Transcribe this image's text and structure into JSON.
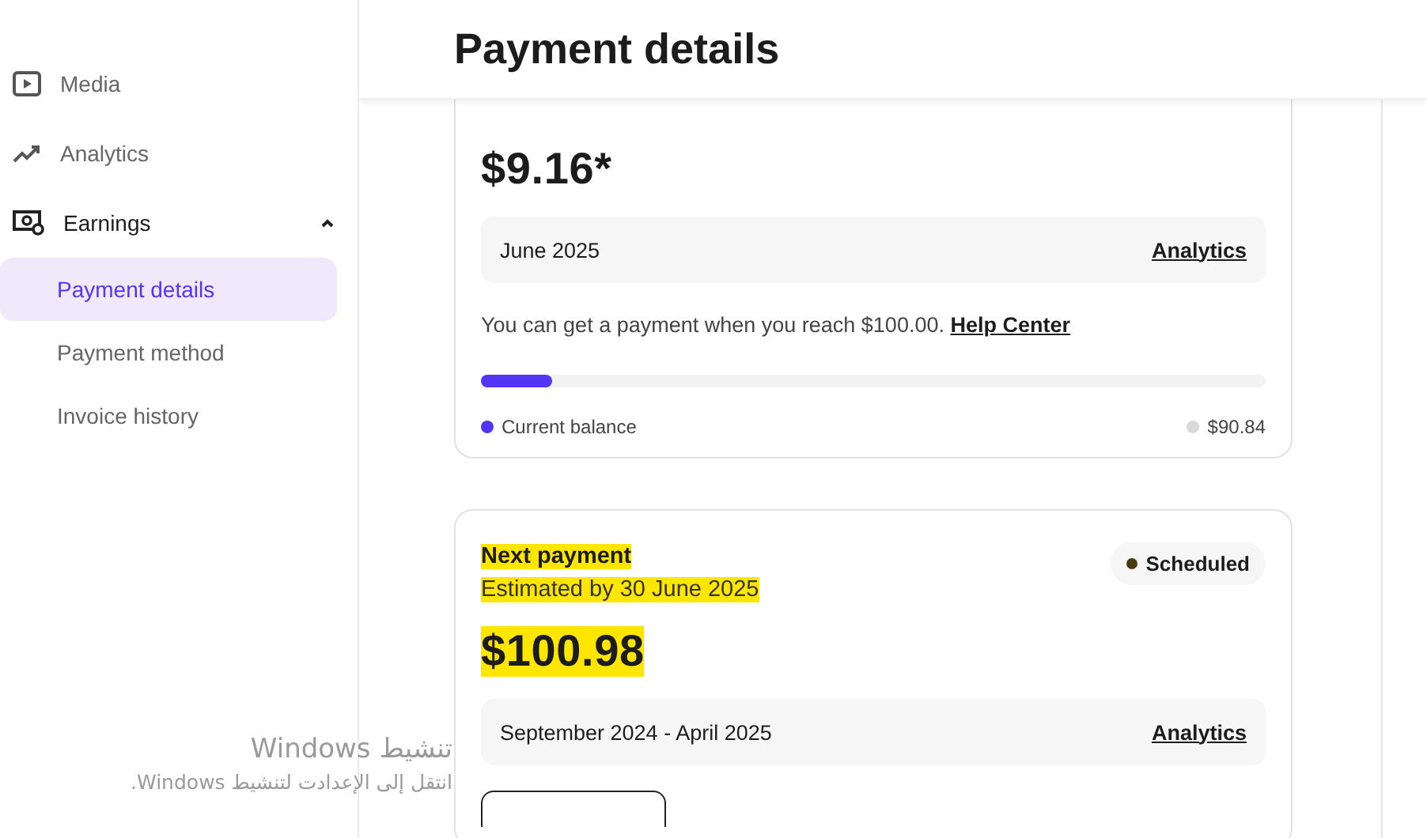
{
  "sidebar": {
    "items": [
      {
        "label": "Media",
        "selected": false
      },
      {
        "label": "Analytics",
        "selected": false
      },
      {
        "label": "Earnings",
        "selected": false,
        "expanded": true,
        "children": [
          {
            "label": "Payment details",
            "selected": true
          },
          {
            "label": "Payment method",
            "selected": false
          },
          {
            "label": "Invoice history",
            "selected": false
          }
        ]
      }
    ]
  },
  "header": {
    "title": "Payment details"
  },
  "balance_card": {
    "amount": "$9.16*",
    "period": "June 2025",
    "period_link": "Analytics",
    "note": "You can get a payment when you reach $100.00.",
    "note_link": "Help Center",
    "progress": {
      "level": 0.09
    },
    "legend": [
      {
        "label": "Current balance",
        "color": "#5235f5"
      },
      {
        "label": "$90.84",
        "color": "#d9d9d9"
      }
    ]
  },
  "next_payment_card": {
    "title": "Next payment",
    "subtitle": "Estimated by 30 June 2025",
    "amount": "$100.98",
    "status": "Scheduled",
    "period": "September 2024 - April 2025",
    "period_link": "Analytics",
    "highlighted": true
  },
  "os_activation_notice": {
    "title": "تنشيط Windows",
    "message": "انتقل إلى الإعدادت لتنشيط Windows."
  }
}
